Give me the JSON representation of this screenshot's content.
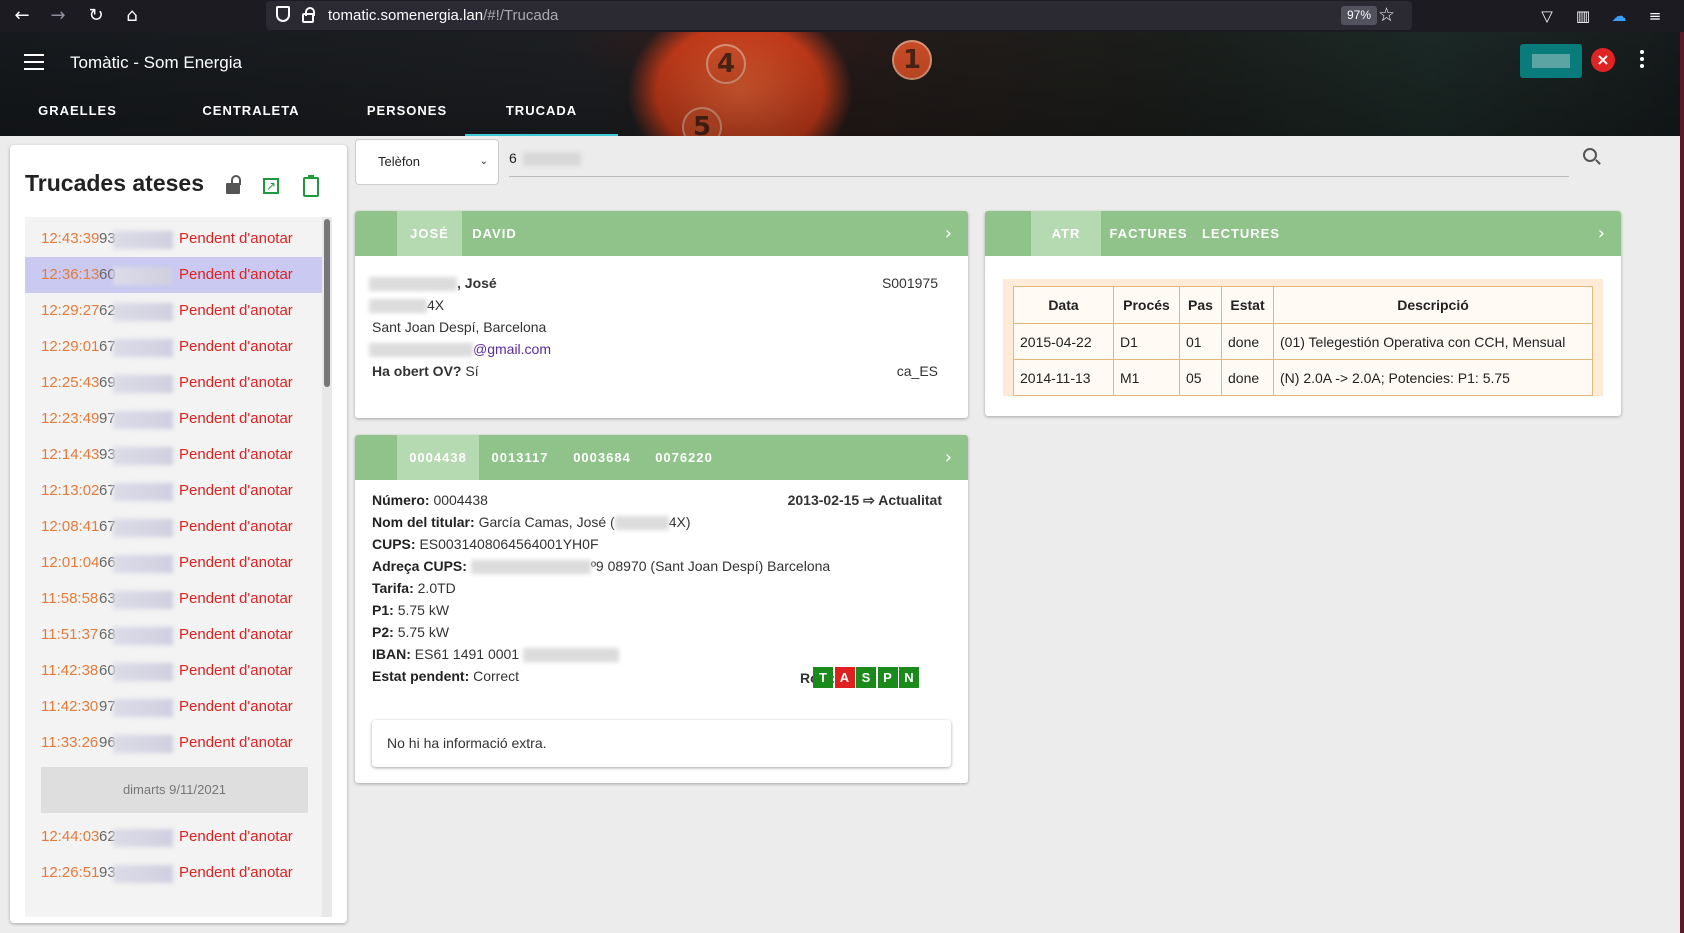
{
  "browser": {
    "url_domain": "tomatic.somenergia.lan",
    "url_path": "/#!/Trucada",
    "zoom": "97%"
  },
  "app": {
    "title": "Tomàtic - Som Energia",
    "tabs": [
      "GRAELLES",
      "CENTRALETA",
      "PERSONES",
      "TRUCADA"
    ],
    "active_tab": "TRUCADA",
    "accent_color": "#3ec8d8"
  },
  "left_panel": {
    "title": "Trucades ateses",
    "calls": [
      {
        "time": "12:43:39",
        "num": "93",
        "status": "Pendent d'anotar"
      },
      {
        "time": "12:36:13",
        "num": "60",
        "status": "Pendent d'anotar"
      },
      {
        "time": "12:29:27",
        "num": "62",
        "status": "Pendent d'anotar"
      },
      {
        "time": "12:29:01",
        "num": "67",
        "status": "Pendent d'anotar"
      },
      {
        "time": "12:25:43",
        "num": "69",
        "status": "Pendent d'anotar"
      },
      {
        "time": "12:23:49",
        "num": "97",
        "status": "Pendent d'anotar"
      },
      {
        "time": "12:14:43",
        "num": "93",
        "status": "Pendent d'anotar"
      },
      {
        "time": "12:13:02",
        "num": "67",
        "status": "Pendent d'anotar"
      },
      {
        "time": "12:08:41",
        "num": "67",
        "status": "Pendent d'anotar"
      },
      {
        "time": "12:01:04",
        "num": "66",
        "status": "Pendent d'anotar"
      },
      {
        "time": "11:58:58",
        "num": "63",
        "status": "Pendent d'anotar"
      },
      {
        "time": "11:51:37",
        "num": "68",
        "status": "Pendent d'anotar"
      },
      {
        "time": "11:42:38",
        "num": "60",
        "status": "Pendent d'anotar"
      },
      {
        "time": "11:42:30",
        "num": "97",
        "status": "Pendent d'anotar"
      },
      {
        "time": "11:33:26",
        "num": "96",
        "status": "Pendent d'anotar"
      }
    ],
    "day_separator": "dimarts 9/11/2021",
    "calls_after": [
      {
        "time": "12:44:03",
        "num": "62",
        "status": "Pendent d'anotar"
      },
      {
        "time": "12:26:51",
        "num": "93",
        "status": "Pendent d'anotar"
      }
    ]
  },
  "search": {
    "field_option": "Telèfon",
    "value": "6"
  },
  "person_card": {
    "tabs": [
      "JOSÉ",
      "DAVID"
    ],
    "name_suffix": ", José",
    "code": "S001975",
    "vat_suffix": "4X",
    "city": "Sant Joan Despí, Barcelona",
    "email_suffix": "@gmail.com",
    "ov_label": "Ha obert OV?",
    "ov_value": "Sí",
    "lang": "ca_ES"
  },
  "atr_card": {
    "tabs": [
      "ATR",
      "FACTURES",
      "LECTURES"
    ],
    "headers": [
      "Data",
      "Procés",
      "Pas",
      "Estat",
      "Descripció"
    ],
    "rows": [
      [
        "2015-04-22",
        "D1",
        "01",
        "done",
        "(01) Telegestión Operativa con CCH, Mensual"
      ],
      [
        "2014-11-13",
        "M1",
        "05",
        "done",
        "(N) 2.0A -> 2.0A; Potencies: P1: 5.75"
      ]
    ]
  },
  "contract_card": {
    "tabs": [
      "0004438",
      "0013117",
      "0003684",
      "0076220"
    ],
    "numero_label": "Número:",
    "numero": "0004438",
    "date_text": "2013-02-15 ⇨ Actualitat",
    "titular_label": "Nom del titular:",
    "titular": "García Camas, José (",
    "titular_end": "4X)",
    "cups_label": "CUPS:",
    "cups": "ES0031408064564001YH0F",
    "adreca_label": "Adreça CUPS:",
    "adreca": "º9 08970 (Sant Joan Despí) Barcelona",
    "tarifa_label": "Tarifa:",
    "tarifa": "2.0TD",
    "p1_label": "P1:",
    "p1": "5.75 kW",
    "p2_label": "P2:",
    "p2": "5.75 kW",
    "iban_label": "IBAN:",
    "iban": "ES61 1491 0001",
    "estat_label": "Estat pendent:",
    "estat": "Correct",
    "rols_label": "Rols:",
    "rols": [
      {
        "letter": "T",
        "active": true
      },
      {
        "letter": "A",
        "active": false
      },
      {
        "letter": "S",
        "active": true
      },
      {
        "letter": "P",
        "active": true
      },
      {
        "letter": "N",
        "active": true
      }
    ],
    "extra": "No hi ha informació extra."
  }
}
